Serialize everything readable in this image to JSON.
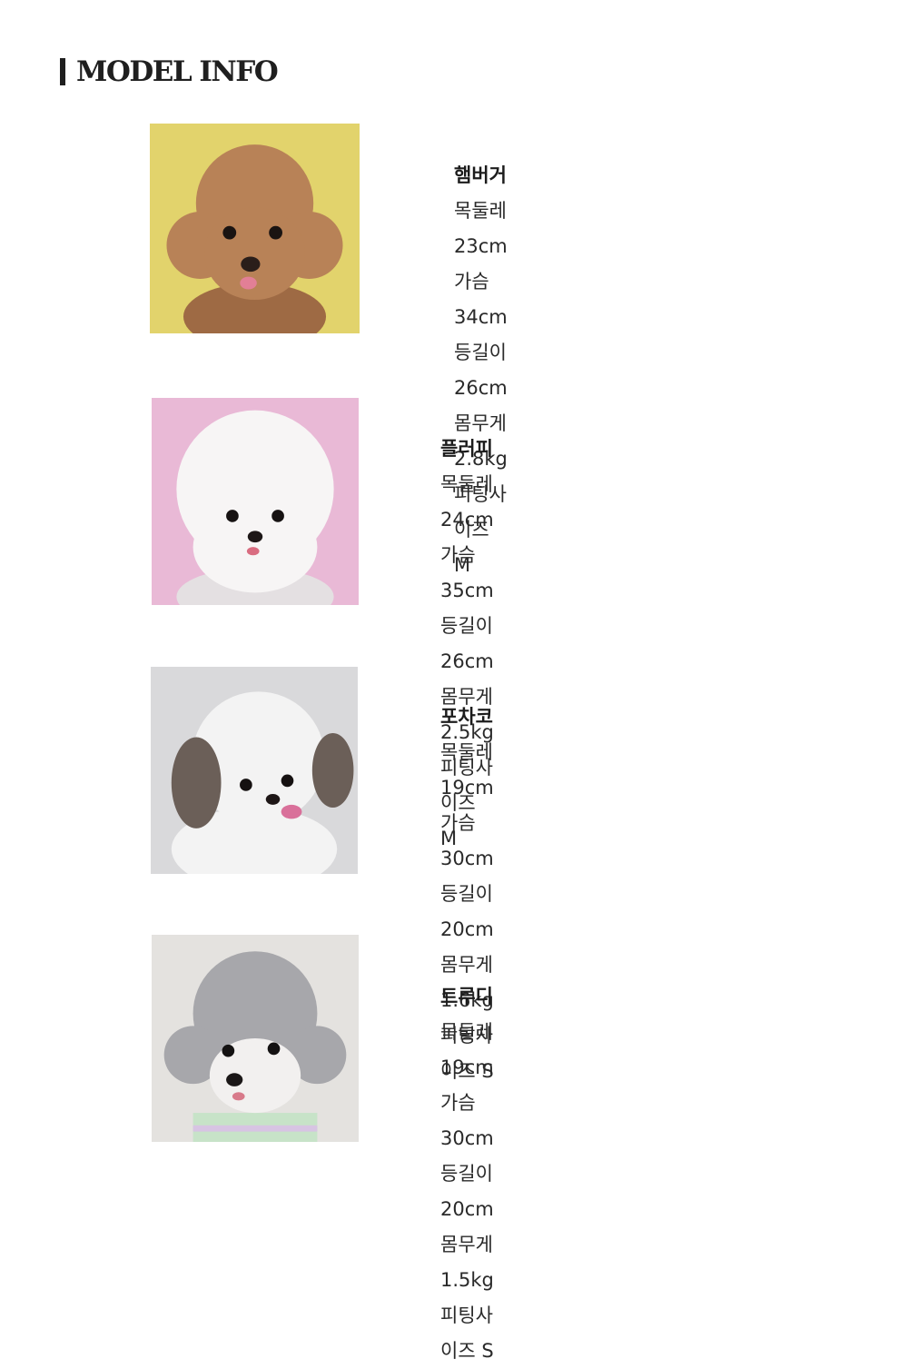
{
  "header": {
    "title": "MODEL INFO"
  },
  "models": [
    {
      "name": "햄버거",
      "measurements": "목둘레 23cm 가슴 34cm 등길이 26cm",
      "weight": "몸무게 2.8kg",
      "fit": "피팅사이즈 M",
      "photo": {
        "background": "#e2d36c",
        "fur": "#b88257",
        "fur_shade": "#9e6a44"
      }
    },
    {
      "name": "플러피",
      "measurements": "목둘레 24cm 가슴 35cm 등길이 26cm",
      "weight": "몸무게 2.5kg",
      "fit": "피팅사이즈 M",
      "photo": {
        "background": "#e9b9d6",
        "fur": "#f7f5f5",
        "fur_shade": "#e4e0e2"
      }
    },
    {
      "name": "포차코",
      "measurements": "목둘레 19cm 가슴 30cm 등길이 20cm",
      "weight": "몸무게 1.6kg",
      "fit": "피팅사이즈 S",
      "photo": {
        "background": "#d9d9db",
        "fur": "#f3f3f3",
        "fur_shade": "#6b5f58"
      }
    },
    {
      "name": "트루디",
      "measurements": "목둘레 19cm 가슴 30cm 등길이 20cm",
      "weight": "몸무게 1.5kg",
      "fit": "피팅사이즈 S",
      "photo": {
        "background": "#e4e2df",
        "fur": "#a7a7ab",
        "fur_shade": "#f2f0ef"
      }
    }
  ]
}
